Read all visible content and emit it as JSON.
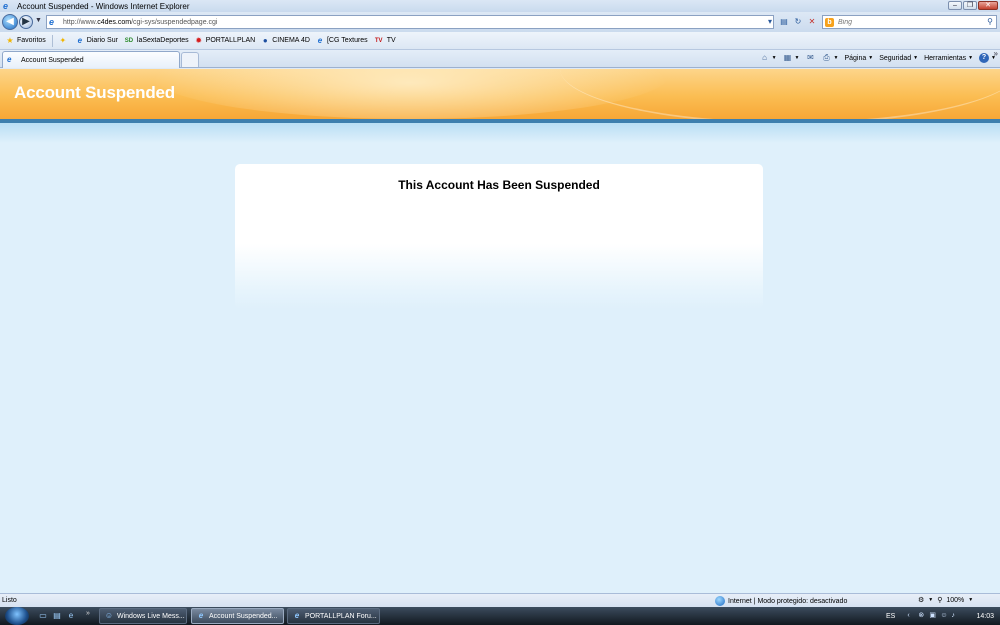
{
  "window": {
    "title": "Account Suspended - Windows Internet Explorer"
  },
  "address_bar": {
    "url_prefix": "http://www.",
    "url_domain": "c4des.com",
    "url_path": "/cgi-sys/suspendedpage.cgi"
  },
  "search": {
    "placeholder": "Bing"
  },
  "favorites_bar": {
    "favorites_label": "Favoritos",
    "items": [
      {
        "label": "Diario Sur",
        "icon": "ie-page-icon"
      },
      {
        "label": "laSextaDeportes",
        "icon": "sd-icon"
      },
      {
        "label": "PORTALLPLAN",
        "icon": "red-gear-icon"
      },
      {
        "label": "CINEMA 4D",
        "icon": "globe-icon"
      },
      {
        "label": "[CG Textures",
        "icon": "ie-page-icon"
      },
      {
        "label": "TV",
        "icon": "tv-icon"
      }
    ]
  },
  "tab": {
    "label": "Account Suspended"
  },
  "command_bar": {
    "page": "Página",
    "safety": "Seguridad",
    "tools": "Herramientas"
  },
  "page": {
    "banner_title": "Account Suspended",
    "heading": "This Account Has Been Suspended"
  },
  "status_bar": {
    "status": "Listo",
    "zone": "Internet | Modo protegido: desactivado",
    "zoom": "100%"
  },
  "taskbar": {
    "buttons": [
      {
        "label": "Windows Live Mess...",
        "active": false
      },
      {
        "label": "Account Suspended...",
        "active": true
      },
      {
        "label": "PORTALLPLAN Foru...",
        "active": false
      }
    ],
    "language": "ES",
    "clock": "14:03"
  },
  "colors": {
    "banner_orange": "#f7a736",
    "banner_line": "#3e7fae",
    "page_background": "#dff0fb"
  }
}
